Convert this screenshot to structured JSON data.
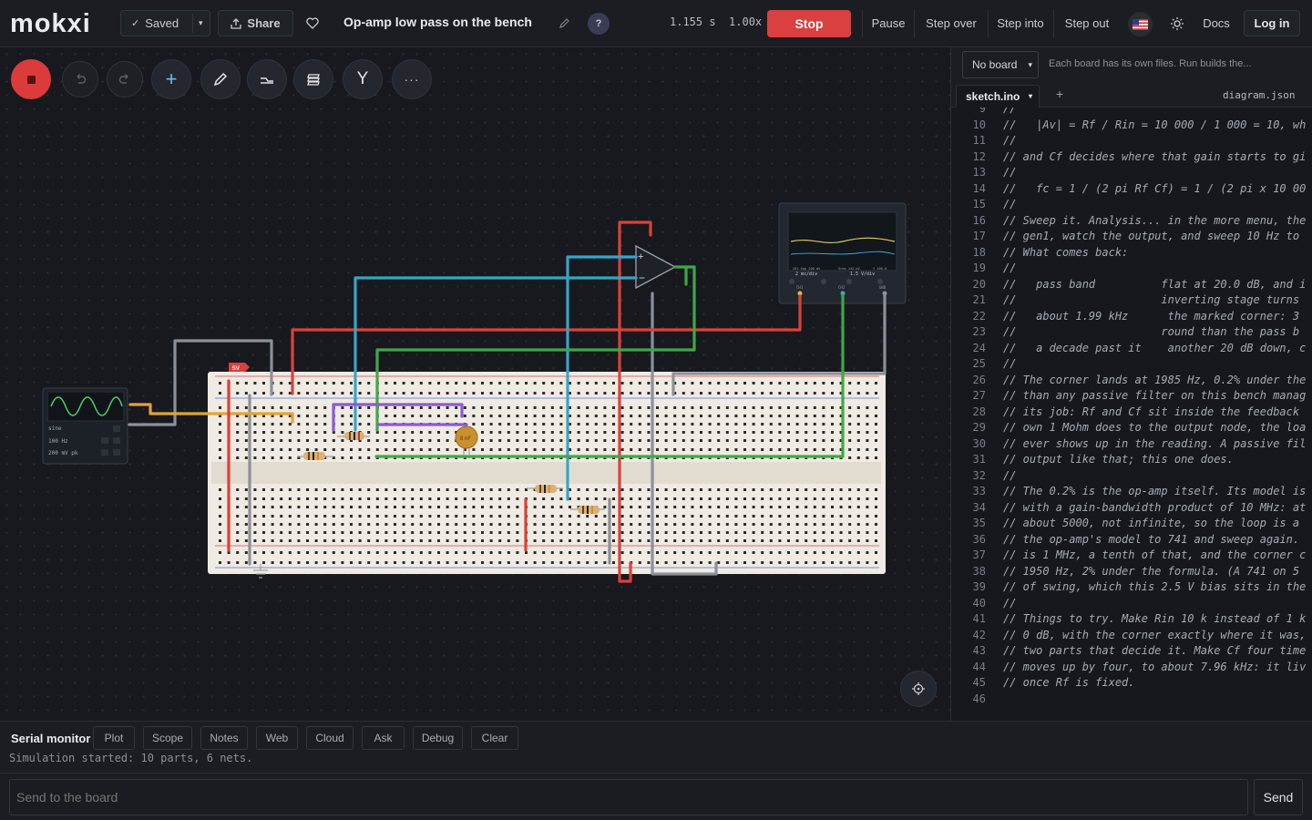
{
  "app": {
    "logo_main": "mokxi"
  },
  "topbar": {
    "saved_label": "Saved",
    "share_label": "Share",
    "project_title": "Op-amp low pass on the bench",
    "help_label": "?",
    "sim_time": "1.155 s",
    "sim_speed": "1.00x",
    "stop_label": "Stop",
    "pause_label": "Pause",
    "step_over_label": "Step over",
    "step_into_label": "Step into",
    "step_out_label": "Step out",
    "docs_label": "Docs",
    "login_label": "Log in"
  },
  "circuit": {
    "rail_label": "5V",
    "generator": {
      "waveform": "sine",
      "frequency": "100 Hz",
      "amplitude": "200 mV pk"
    },
    "capacitor_label": "8 nF",
    "scope": {
      "ch1_readout": "CH1  Vpp 200 mV",
      "ch2_readout": "Vrms 142 mV",
      "timebase": "2 ms/div",
      "vdiv": "1.5 V/div",
      "freq_readout": "f 100.0",
      "ch1": "CH1",
      "ch2": "CH2",
      "gnd": "GND"
    }
  },
  "panel": {
    "board_select": "No board",
    "board_hint": "Each board has its own files. Run builds the...",
    "active_file": "sketch.ino",
    "add_tab": "+",
    "other_file": "diagram.json"
  },
  "code_lines": [
    {
      "n": "9",
      "t": "//"
    },
    {
      "n": "10",
      "t": "//   |Av| = Rf / Rin = 10 000 / 1 000 = 10, wh"
    },
    {
      "n": "11",
      "t": "//"
    },
    {
      "n": "12",
      "t": "// and Cf decides where that gain starts to gi"
    },
    {
      "n": "13",
      "t": "//"
    },
    {
      "n": "14",
      "t": "//   fc = 1 / (2 pi Rf Cf) = 1 / (2 pi x 10 00"
    },
    {
      "n": "15",
      "t": "//"
    },
    {
      "n": "16",
      "t": "// Sweep it. Analysis... in the more menu, the"
    },
    {
      "n": "17",
      "t": "// gen1, watch the output, and sweep 10 Hz to"
    },
    {
      "n": "18",
      "t": "// What comes back:"
    },
    {
      "n": "19",
      "t": "//"
    },
    {
      "n": "20",
      "t": "//   pass band          flat at 20.0 dB, and i"
    },
    {
      "n": "21",
      "t": "//                      inverting stage turns"
    },
    {
      "n": "22",
      "t": "//   about 1.99 kHz      the marked corner: 3"
    },
    {
      "n": "23",
      "t": "//                      round than the pass b"
    },
    {
      "n": "24",
      "t": "//   a decade past it    another 20 dB down, c"
    },
    {
      "n": "25",
      "t": "//"
    },
    {
      "n": "26",
      "t": "// The corner lands at 1985 Hz, 0.2% under the"
    },
    {
      "n": "27",
      "t": "// than any passive filter on this bench manag"
    },
    {
      "n": "28",
      "t": "// its job: Rf and Cf sit inside the feedback"
    },
    {
      "n": "29",
      "t": "// own 1 Mohm does to the output node, the loa"
    },
    {
      "n": "30",
      "t": "// ever shows up in the reading. A passive fil"
    },
    {
      "n": "31",
      "t": "// output like that; this one does."
    },
    {
      "n": "32",
      "t": "//"
    },
    {
      "n": "33",
      "t": "// The 0.2% is the op-amp itself. Its model is"
    },
    {
      "n": "34",
      "t": "// with a gain-bandwidth product of 10 MHz: at"
    },
    {
      "n": "35",
      "t": "// about 5000, not infinite, so the loop is a"
    },
    {
      "n": "36",
      "t": "// the op-amp's model to 741 and sweep again."
    },
    {
      "n": "37",
      "t": "// is 1 MHz, a tenth of that, and the corner c"
    },
    {
      "n": "38",
      "t": "// 1950 Hz, 2% under the formula. (A 741 on 5"
    },
    {
      "n": "39",
      "t": "// of swing, which this 2.5 V bias sits in the"
    },
    {
      "n": "40",
      "t": "//"
    },
    {
      "n": "41",
      "t": "// Things to try. Make Rin 10 k instead of 1 k"
    },
    {
      "n": "42",
      "t": "// 0 dB, with the corner exactly where it was,"
    },
    {
      "n": "43",
      "t": "// two parts that decide it. Make Cf four time"
    },
    {
      "n": "44",
      "t": "// moves up by four, to about 7.96 kHz: it liv"
    },
    {
      "n": "45",
      "t": "// once Rf is fixed."
    },
    {
      "n": "46",
      "t": ""
    }
  ],
  "bottom": {
    "serial_label": "Serial monitor",
    "tabs": [
      "Plot",
      "Scope",
      "Notes",
      "Web",
      "Cloud",
      "Ask",
      "Debug",
      "Clear"
    ],
    "log": "Simulation started: 10 parts, 6 nets.",
    "send_placeholder": "Send to the board",
    "send_label": "Send"
  },
  "colors": {
    "stop": "#d9403f",
    "record": "#dc3b3b",
    "wire_red": "#d9423a",
    "wire_green": "#3fa845",
    "wire_blue": "#32a7c9",
    "wire_purple": "#8a5ad6",
    "wire_orange": "#e3a23a",
    "wire_gray": "#8c9099"
  }
}
